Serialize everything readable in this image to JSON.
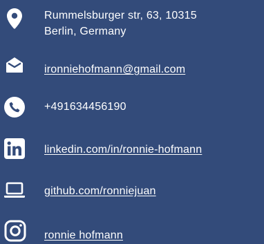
{
  "contact": {
    "address_line1": "Rummelsburger str, 63, 10315",
    "address_line2": "Berlin, Germany",
    "email": "ironniehofmann@gmail.com",
    "phone": "+491634456190",
    "linkedin": "linkedin.com/in/ronnie-hofmann",
    "github": "github.com/ronniejuan",
    "instagram": "ronnie hofmann"
  },
  "icons": {
    "address": "location-pin-icon",
    "email": "envelope-icon",
    "phone": "phone-icon",
    "linkedin": "linkedin-icon",
    "github": "laptop-icon",
    "instagram": "instagram-icon"
  },
  "colors": {
    "background": "#334b7a",
    "foreground": "#ffffff"
  }
}
